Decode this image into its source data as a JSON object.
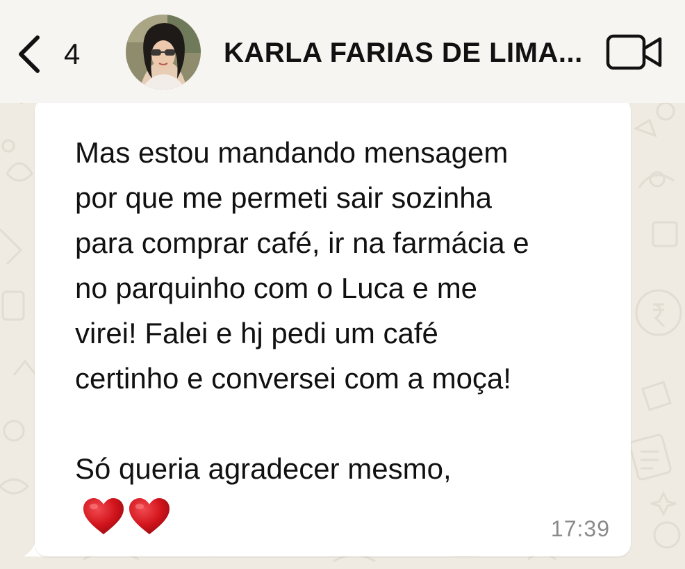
{
  "header": {
    "back_icon": "chevron-left-icon",
    "unread_count": "4",
    "contact_name": "KARLA FARIAS DE LIMA...",
    "avatar": "profile-photo",
    "video_icon": "video-camera-icon"
  },
  "message": {
    "text": "Mas estou mandando mensagem\npor que me permeti sair sozinha\npara comprar café, ir na farmácia e\nno parquinho com o Luca e me\nvirei! Falei e hj pedi um café\ncertinho e conversei com a moça!\n\nSó queria agradecer mesmo,",
    "emoji": [
      "❤️",
      "❤️"
    ],
    "emoji_icons": [
      "heart-icon",
      "heart-icon"
    ],
    "time": "17:39"
  },
  "colors": {
    "wallpaper": "#efeae2",
    "bubble": "#ffffff",
    "text": "#111111",
    "timestamp": "#8a8a8a",
    "heart": "#d2141c"
  }
}
